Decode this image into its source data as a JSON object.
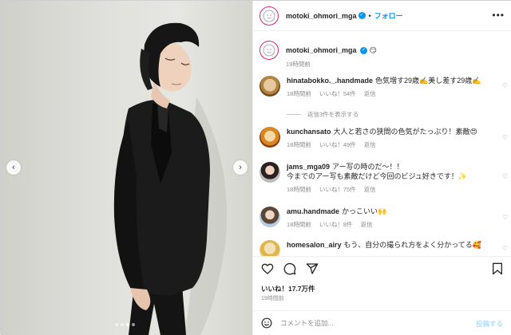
{
  "post": {
    "username": "motoki_ohmori_mga",
    "follow_label": "フォロー",
    "header_separator": "•",
    "more_label": "•••",
    "caption_emoji": "😏",
    "caption_time": "19時間前"
  },
  "photo": {
    "prev_label": "‹",
    "next_label": "›",
    "slide_count": 4,
    "active_slide": 3
  },
  "comments": [
    {
      "username": "hinatabokko._.handmade",
      "text": "色気増す29歳✍️美し差す29歳✍️",
      "time": "18時間前",
      "likes": "いいね！54件",
      "reply_label": "返信"
    },
    {
      "username": "kunchansato",
      "text": "大人と若さの狭間の色気がたっぷり！素敵😍",
      "time": "18時間前",
      "likes": "いいね！49件",
      "reply_label": "返信"
    },
    {
      "username": "jams_mga09",
      "text": "アー写の時のだ〜！！",
      "text2": "今までのアー写も素敵だけど今回のビジュ好きです！✨",
      "time": "18時間前",
      "likes": "いいね！75件",
      "reply_label": "返信"
    },
    {
      "username": "amu.handmade",
      "text": "かっこいい🙌",
      "time": "18時間前",
      "likes": "いいね！8件",
      "reply_label": "返信"
    },
    {
      "username": "homesalon_airy",
      "text": "もう、自分の撮られ方をよく分かってる🥰"
    }
  ],
  "view_replies": "返信3件を表示する",
  "actions": {
    "likes_count": "いいね！17.7万件",
    "post_time": "19時間前"
  },
  "comment_input": {
    "placeholder": "コメントを追加...",
    "post_label": "投稿する"
  },
  "colors": {
    "accent": "#0095f6",
    "muted": "#8e8e8e",
    "post_disabled": "#b3dffc"
  }
}
